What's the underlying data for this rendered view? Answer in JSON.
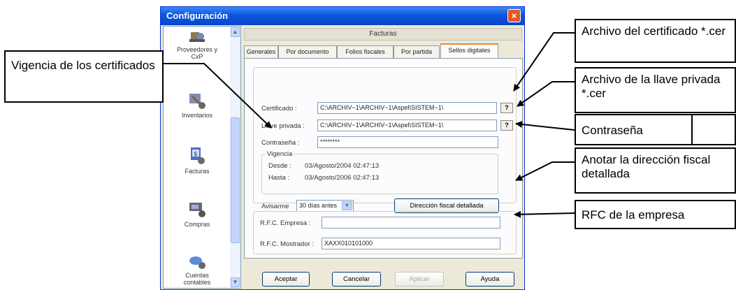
{
  "window": {
    "title": "Configuración",
    "close_glyph": "×"
  },
  "nav": {
    "items": [
      {
        "label_line1": "Proveedores y",
        "label_line2": "CxP",
        "icon": "suppliers-icon"
      },
      {
        "label_line1": "Inventarios",
        "label_line2": "",
        "icon": "inventory-icon"
      },
      {
        "label_line1": "Facturas",
        "label_line2": "",
        "icon": "invoice-icon"
      },
      {
        "label_line1": "Compras",
        "label_line2": "",
        "icon": "purchases-icon"
      },
      {
        "label_line1": "Cuentas",
        "label_line2": "contables",
        "icon": "accounts-icon"
      }
    ],
    "scroll_up": "▲",
    "scroll_down": "▼"
  },
  "panel": {
    "title": "Facturas",
    "tabs": [
      "Generales",
      "Por documento",
      "Folios fiscales",
      "Por partida",
      "Sellos digitales"
    ],
    "active_tab": "Sellos digitales"
  },
  "form": {
    "certificado_label": "Certificado :",
    "certificado_value": "C:\\ARCHIV~1\\ARCHIV~1\\Aspel\\SISTEM~1\\",
    "llave_label": "Llave privada :",
    "llave_value": "C:\\ARCHIV~1\\ARCHIV~1\\Aspel\\SISTEM~1\\",
    "browse_glyph": "?",
    "contrasena_label": "Contraseña :",
    "contrasena_value": "********",
    "vigencia_title": "Vigencia",
    "desde_label": "Desde :",
    "desde_value": "03/Agosto/2004 02:47:13",
    "hasta_label": "Hasta :",
    "hasta_value": "03/Agosto/2006 02:47:13",
    "avisarme_label": "Avisarme",
    "avisarme_value": "30 días antes",
    "combo_glyph": "▼",
    "direccion_button": "Dirección fiscal detallada",
    "rfc_empresa_label": "R.F.C. Empresa :",
    "rfc_empresa_value": "",
    "rfc_mostrador_label": "R.F.C. Mostrador :",
    "rfc_mostrador_value": "XAXX010101000"
  },
  "buttons": {
    "aceptar": "Aceptar",
    "cancelar": "Cancelar",
    "aplicar": "Aplicar",
    "ayuda": "Ayuda"
  },
  "callouts": {
    "vigencia": "Vigencia de los certificados",
    "certificado": "Archivo del certificado *.cer",
    "llave": "Archivo de la llave privada *.cer",
    "contrasena": "Contraseña",
    "direccion": "Anotar la dirección fiscal detallada",
    "rfc": "RFC de la empresa"
  }
}
